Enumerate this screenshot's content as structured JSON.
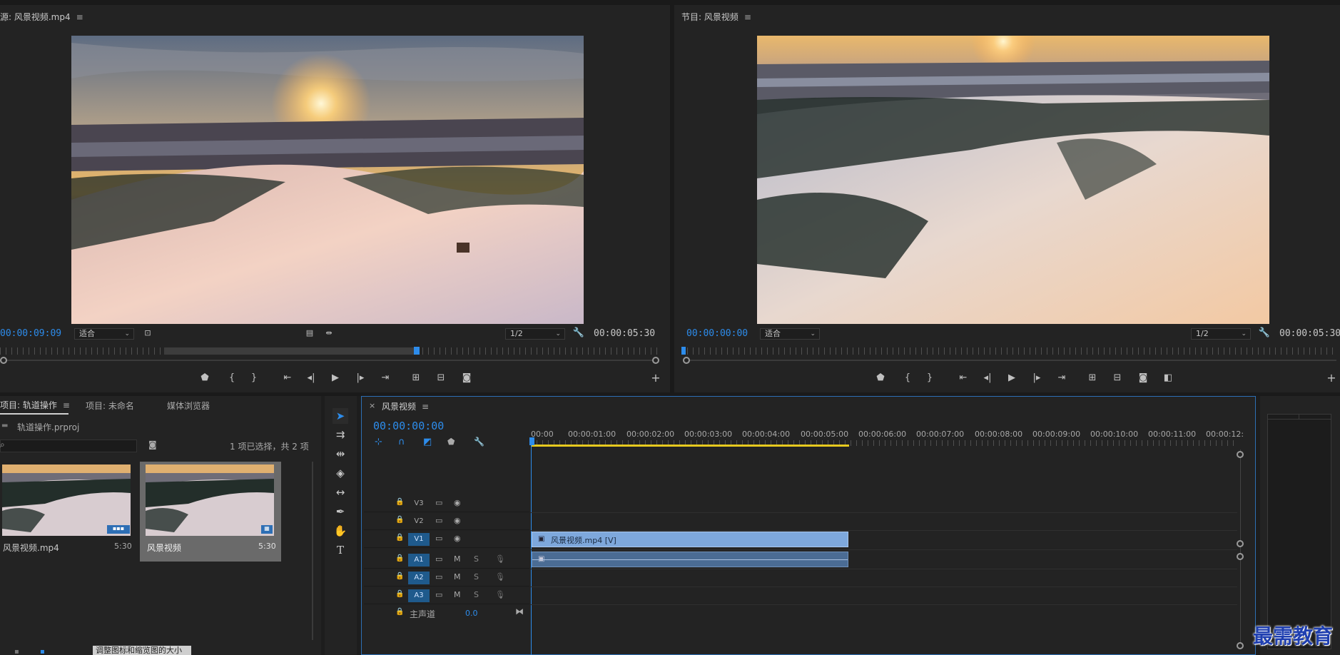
{
  "source_monitor": {
    "title": "源: 风景视频.mp4",
    "timecode": "00:00:09:09",
    "fit": "适合",
    "resolution": "1/2",
    "duration": "00:00:05:30"
  },
  "program_monitor": {
    "title": "节目: 风景视频",
    "timecode": "00:00:00:00",
    "fit": "适合",
    "resolution": "1/2",
    "duration": "00:00:05:30"
  },
  "project_panel": {
    "tabs": [
      "项目: 轨道操作",
      "项目: 未命名",
      "媒体浏览器"
    ],
    "file": "轨道操作.prproj",
    "selection_count": "1 项已选择，共 2 项",
    "items": [
      {
        "name": "风景视频.mp4",
        "duration": "5:30"
      },
      {
        "name": "风景视频",
        "duration": "5:30"
      }
    ],
    "tooltip": "调整图标和缩览图的大小"
  },
  "timeline": {
    "tab": "风景视频",
    "timecode": "00:00:00:00",
    "ruler": [
      "00:00",
      "00:00:01:00",
      "00:00:02:00",
      "00:00:03:00",
      "00:00:04:00",
      "00:00:05:00",
      "00:00:06:00",
      "00:00:07:00",
      "00:00:08:00",
      "00:00:09:00",
      "00:00:10:00",
      "00:00:11:00",
      "00:00:12:"
    ],
    "tracks": {
      "v3": "V3",
      "v2": "V2",
      "v1": "V1",
      "a1": "A1",
      "a2": "A2",
      "a3": "A3",
      "m": "M",
      "s": "S"
    },
    "master": {
      "label": "主声道",
      "value": "0.0"
    },
    "clip_label": "风景视频.mp4 [V]"
  },
  "watermark": "最需教育",
  "colors": {
    "accent": "#2d8ceb",
    "clip_video": "#7ea8dc",
    "clip_audio": "#4b6c94",
    "track_on": "#1f5a8c",
    "work_area": "#e6c91e"
  }
}
